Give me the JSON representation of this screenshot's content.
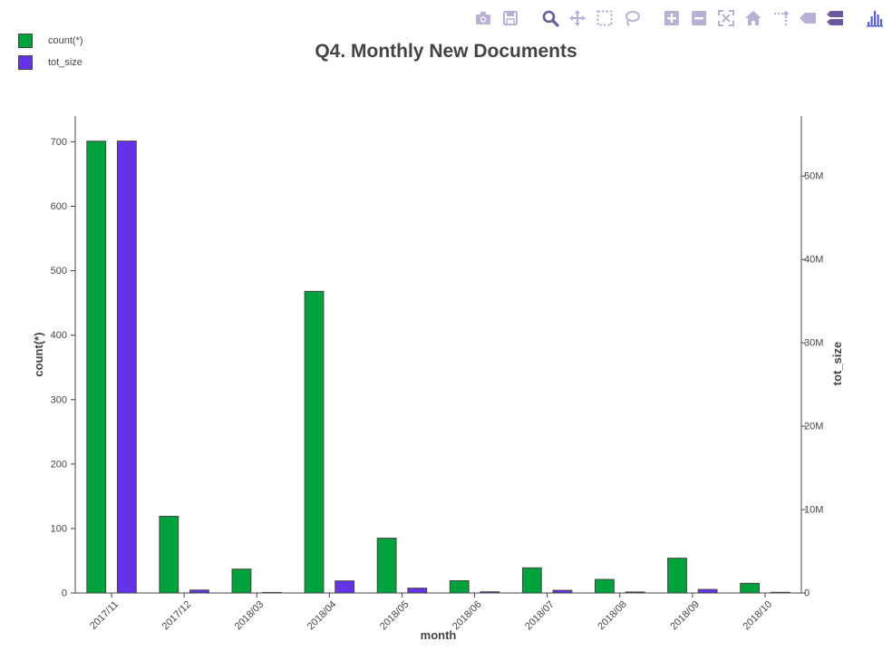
{
  "modebar": {
    "groups": [
      [
        {
          "name": "camera-icon"
        },
        {
          "name": "save-icon"
        }
      ],
      [
        {
          "name": "zoom-icon"
        },
        {
          "name": "pan-icon"
        },
        {
          "name": "box-select-icon"
        },
        {
          "name": "lasso-select-icon"
        }
      ],
      [
        {
          "name": "zoom-in-icon"
        },
        {
          "name": "zoom-out-icon"
        },
        {
          "name": "autoscale-icon"
        },
        {
          "name": "reset-axes-icon"
        },
        {
          "name": "spike-lines-icon"
        },
        {
          "name": "hover-closest-icon"
        },
        {
          "name": "hover-compare-icon"
        }
      ],
      [
        {
          "name": "plotly-logo-icon"
        }
      ]
    ]
  },
  "colors": {
    "count": "#00a23c",
    "tot_size": "#6433e8",
    "toolbar_icon": "#b9b0d4",
    "toolbar_active": "#6b5a9c",
    "logo": "#5b5fc7"
  },
  "chart_data": {
    "type": "bar",
    "title": "Q4. Monthly New Documents",
    "xlabel": "month",
    "ylabel": "count(*)",
    "y2label": "tot_size",
    "categories": [
      "2017/11",
      "2017/12",
      "2018/03",
      "2018/04",
      "2018/05",
      "2018/06",
      "2018/07",
      "2018/08",
      "2018/09",
      "2018/10"
    ],
    "series": [
      {
        "name": "count(*)",
        "axis": "y",
        "values": [
          701,
          119,
          37,
          468,
          85,
          19,
          39,
          21,
          54,
          15
        ]
      },
      {
        "name": "tot_size",
        "axis": "y2",
        "values": [
          54200000,
          350000,
          60000,
          1450000,
          580000,
          140000,
          320000,
          120000,
          420000,
          80000
        ]
      }
    ],
    "ylim": [
      0,
      740
    ],
    "y2lim": [
      0,
      57200000
    ],
    "yticks": [
      0,
      100,
      200,
      300,
      400,
      500,
      600,
      700
    ],
    "y2ticks": [
      0,
      10000000,
      20000000,
      30000000,
      40000000,
      50000000
    ],
    "y2ticklabels": [
      "0",
      "10M",
      "20M",
      "30M",
      "40M",
      "50M"
    ],
    "grid": false,
    "legend": "top-left"
  }
}
